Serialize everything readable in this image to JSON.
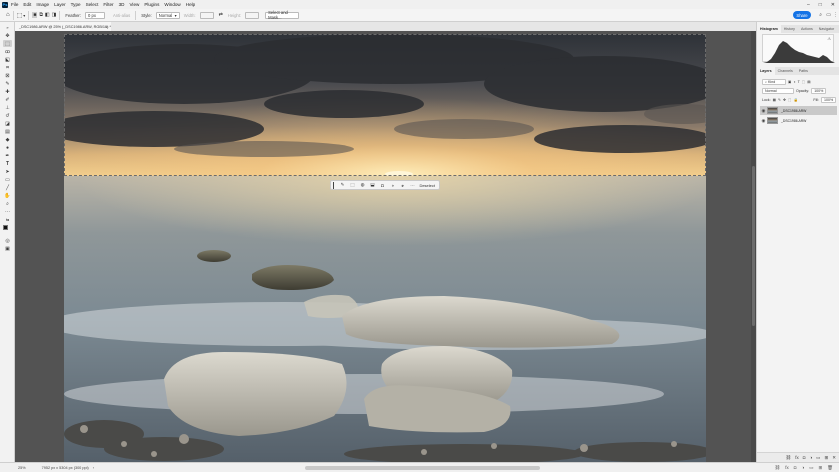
{
  "app": {
    "logo": "Ps",
    "menu": [
      "File",
      "Edit",
      "Image",
      "Layer",
      "Type",
      "Select",
      "Filter",
      "3D",
      "View",
      "Plugins",
      "Window",
      "Help"
    ],
    "window_controls": [
      "–",
      "□",
      "✕"
    ]
  },
  "options": {
    "feather_label": "Feather:",
    "feather_value": "0 px",
    "antialias_label": "Anti-alias",
    "style_label": "Style:",
    "style_value": "Normal",
    "width_label": "Width:",
    "height_label": "Height:",
    "select_mask_label": "Select and Mask...",
    "share_label": "Share"
  },
  "document": {
    "tab_title": "_DSC1986.ARW @ 25% (_DSC1986.ARW, RGB/16) *",
    "tab_close": "×"
  },
  "context_bar": {
    "deselect_label": "Deselect",
    "more_label": "···"
  },
  "status": {
    "zoom": "25%",
    "dimensions": "7952 px x 5304 px (300 ppi)",
    "arrow": "›"
  },
  "panels": {
    "top_tabs": [
      "Histogram",
      "History",
      "Actions",
      "Navigator"
    ],
    "layer_tabs": [
      "Layers",
      "Channels",
      "Paths"
    ],
    "kind_label": "Kind",
    "blend_mode": "Normal",
    "opacity_label": "Opacity:",
    "opacity_value": "100%",
    "lock_label": "Lock:",
    "fill_label": "Fill:",
    "fill_value": "100%",
    "layers": [
      {
        "name": "_DSC1986.ARW",
        "selected": true
      },
      {
        "name": "_DSC1986.ARW",
        "selected": false
      }
    ]
  },
  "colors": {
    "accent": "#1473e6",
    "workspace": "#535353",
    "ui_bg": "#f0f0f0"
  }
}
